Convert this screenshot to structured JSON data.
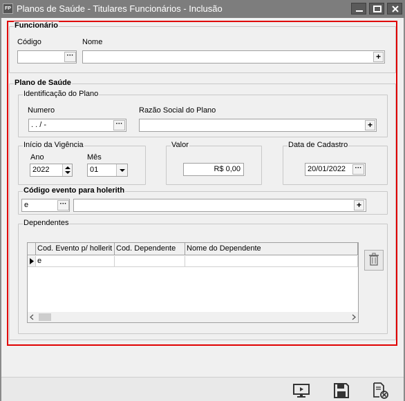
{
  "window": {
    "icon_text": "FP",
    "title": "Planos de Saúde - Titulares Funcionários - Inclusão"
  },
  "funcionario": {
    "group_title": "Funcionário",
    "codigo_label": "Código",
    "codigo_value": "",
    "nome_label": "Nome",
    "nome_value": ""
  },
  "plano": {
    "group_title": "Plano de Saúde",
    "identificacao": {
      "group_title": "Identificação do Plano",
      "numero_label": "Numero",
      "numero_value": " .  .  /   -",
      "razao_label": "Razão Social do Plano",
      "razao_value": ""
    },
    "inicio_vigencia": {
      "group_title": "Início da Vigência",
      "ano_label": "Ano",
      "ano_value": "2022",
      "mes_label": "Mês",
      "mes_value": "01"
    },
    "valor": {
      "group_title": "Valor",
      "value": "R$ 0,00"
    },
    "data_cadastro": {
      "group_title": "Data de Cadastro",
      "value": "20/01/2022"
    },
    "evento_holerith": {
      "group_title": "Código evento para holerith",
      "code_value": "e",
      "desc_value": ""
    },
    "dependentes": {
      "group_title": "Dependentes",
      "columns": [
        "Cod. Evento p/ hollerit",
        "Cod. Dependente",
        "Nome do Dependente"
      ],
      "rows": [
        [
          "e",
          "",
          ""
        ]
      ]
    }
  },
  "icons": {
    "ellipsis": "···",
    "plus": "+"
  }
}
